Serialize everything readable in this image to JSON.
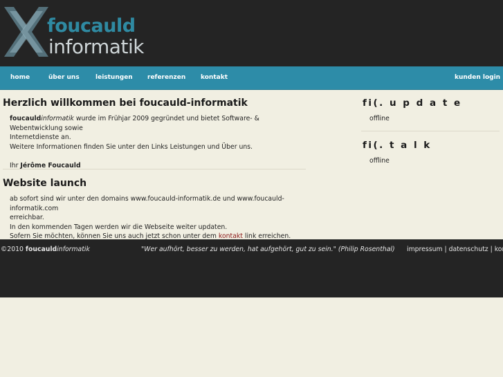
{
  "logo": {
    "word1": "foucauld",
    "word2": "informatik",
    "colors": {
      "x_dark": "#54707a",
      "x_light": "#8fb0bb",
      "word1": "#2f8aa2",
      "word2": "#cfd6d8"
    }
  },
  "nav": {
    "items": [
      {
        "label": "home"
      },
      {
        "label": "über uns"
      },
      {
        "label": "leistungen"
      },
      {
        "label": "referenzen"
      },
      {
        "label": "kontakt"
      }
    ],
    "login": "kunden login",
    "color": "#2d8ca8"
  },
  "welcome": {
    "title": "Herzlich willkommen bei foucauld-informatik",
    "brand_bold": "foucauld",
    "brand_italic": "informatik",
    "line1_rest": " wurde im Frühjar 2009 gegründet und bietet Software- & Webentwicklung sowie",
    "line2": "Internetdienste an.",
    "line3": "Weitere Informationen finden Sie unter den Links Leistungen und Über uns.",
    "sign_prefix": "Ihr ",
    "sign_name": "Jérôme Foucauld"
  },
  "launch": {
    "title": "Website launch",
    "line1": "ab sofort sind wir unter den domains www.foucauld-informatik.de und www.foucauld-informatik.com",
    "line2": "erreichbar.",
    "line3": "In den kommenden Tagen werden wir die Webseite weiter updaten.",
    "line4_before": "Sofern Sie möchten, können Sie uns auch jetzt schon unter dem ",
    "line4_link": "kontakt",
    "line4_after": " link erreichen."
  },
  "sidebar": {
    "update_title": "fi(. u p d a t e",
    "update_status": "offline",
    "talk_title": "fi(. t a l k",
    "talk_status": "offline"
  },
  "footer": {
    "copyright": "©2010 ",
    "brand_bold": "foucauld",
    "brand_italic": "informatik",
    "quote": "\"Wer aufhört, besser zu werden, hat aufgehört, gut zu sein.\" (Philip Rosenthal)",
    "impressum": "impressum",
    "datenschutz": "datenschutz",
    "kontakt": "kontakt",
    "separator": " | "
  }
}
